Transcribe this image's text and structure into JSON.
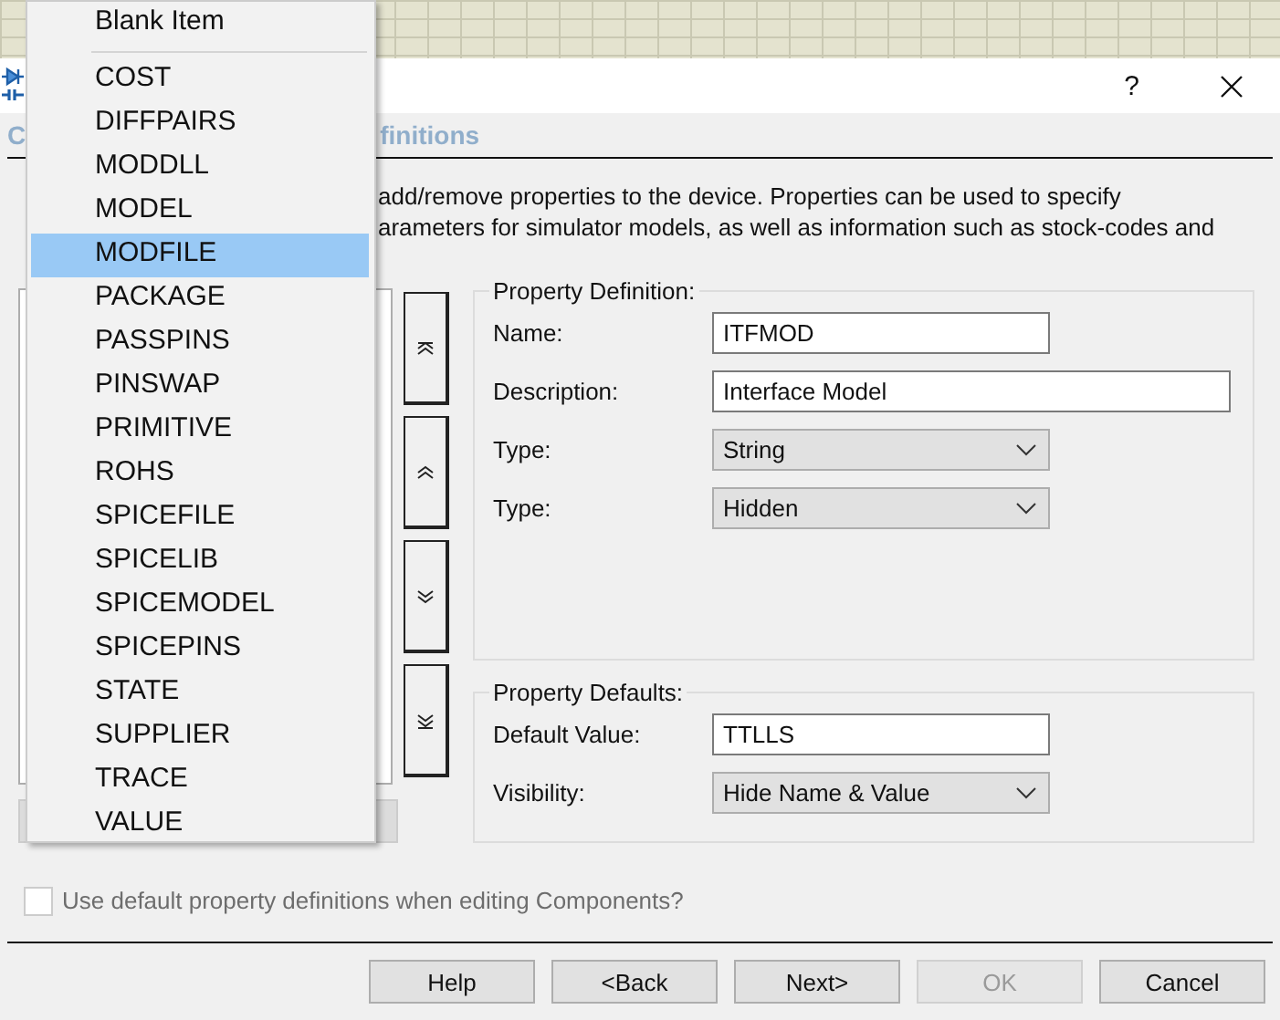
{
  "title_bar": {
    "help": "?"
  },
  "tab_header": {
    "visible_parts": [
      "C",
      "finitions"
    ]
  },
  "description": [
    "add/remove properties to the device. Properties can be used to specify",
    "arameters for simulator models, as well as information such as stock-codes and"
  ],
  "move_buttons": [
    {
      "kind": "top"
    },
    {
      "kind": "up"
    },
    {
      "kind": "down"
    },
    {
      "kind": "bottom"
    }
  ],
  "property_definition": {
    "title": "Property Definition:",
    "fields": [
      {
        "kind": "text",
        "label": "Name:",
        "value": "ITFMOD"
      },
      {
        "kind": "long_text",
        "label": "Description:",
        "value": "Interface Model"
      },
      {
        "kind": "select",
        "label": "Type:",
        "value": "String"
      },
      {
        "kind": "select",
        "label": "Type:",
        "value": "Hidden"
      }
    ]
  },
  "property_defaults": {
    "title": "Property Defaults:",
    "fields": [
      {
        "kind": "text",
        "label": "Default Value:",
        "value": "TTLLS"
      },
      {
        "kind": "select",
        "label": "Visibility:",
        "value": "Hide Name & Value"
      }
    ]
  },
  "checkbox": {
    "label": "Use default property definitions when editing Components?",
    "checked": false,
    "disabled": true
  },
  "buttons": [
    {
      "label": "Help",
      "disabled": false
    },
    {
      "label": "<Back",
      "disabled": false
    },
    {
      "label": "Next>",
      "disabled": false
    },
    {
      "label": "OK",
      "disabled": true
    },
    {
      "label": "Cancel",
      "disabled": false
    }
  ],
  "menu": {
    "items": [
      {
        "kind": "item",
        "label": "Blank Item",
        "selected": false
      },
      {
        "kind": "separator"
      },
      {
        "kind": "item",
        "label": "COST",
        "selected": false
      },
      {
        "kind": "item",
        "label": "DIFFPAIRS",
        "selected": false
      },
      {
        "kind": "item",
        "label": "MODDLL",
        "selected": false
      },
      {
        "kind": "item",
        "label": "MODEL",
        "selected": false
      },
      {
        "kind": "item",
        "label": "MODFILE",
        "selected": true
      },
      {
        "kind": "item",
        "label": "PACKAGE",
        "selected": false
      },
      {
        "kind": "item",
        "label": "PASSPINS",
        "selected": false
      },
      {
        "kind": "item",
        "label": "PINSWAP",
        "selected": false
      },
      {
        "kind": "item",
        "label": "PRIMITIVE",
        "selected": false
      },
      {
        "kind": "item",
        "label": "ROHS",
        "selected": false
      },
      {
        "kind": "item",
        "label": "SPICEFILE",
        "selected": false
      },
      {
        "kind": "item",
        "label": "SPICELIB",
        "selected": false
      },
      {
        "kind": "item",
        "label": "SPICEMODEL",
        "selected": false
      },
      {
        "kind": "item",
        "label": "SPICEPINS",
        "selected": false
      },
      {
        "kind": "item",
        "label": "STATE",
        "selected": false
      },
      {
        "kind": "item",
        "label": "SUPPLIER",
        "selected": false
      },
      {
        "kind": "item",
        "label": "TRACE",
        "selected": false
      },
      {
        "kind": "item",
        "label": "VALUE",
        "selected": false
      }
    ]
  }
}
